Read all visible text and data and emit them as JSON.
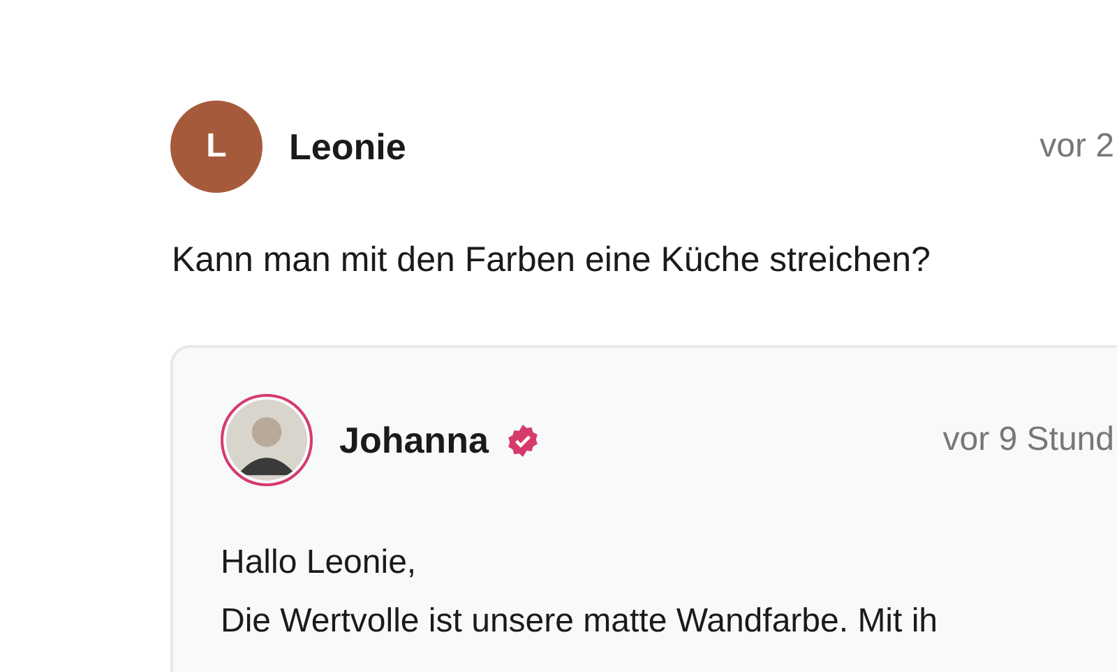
{
  "comment": {
    "author": "Leonie",
    "avatar_letter": "L",
    "time": "vor 2",
    "text": "Kann man mit den Farben eine Küche streichen?"
  },
  "reply": {
    "author": "Johanna",
    "verified": true,
    "time": "vor 9 Stund",
    "lines": [
      "Hallo Leonie,",
      "Die Wertvolle ist unsere matte Wandfarbe. Mit ih"
    ]
  }
}
